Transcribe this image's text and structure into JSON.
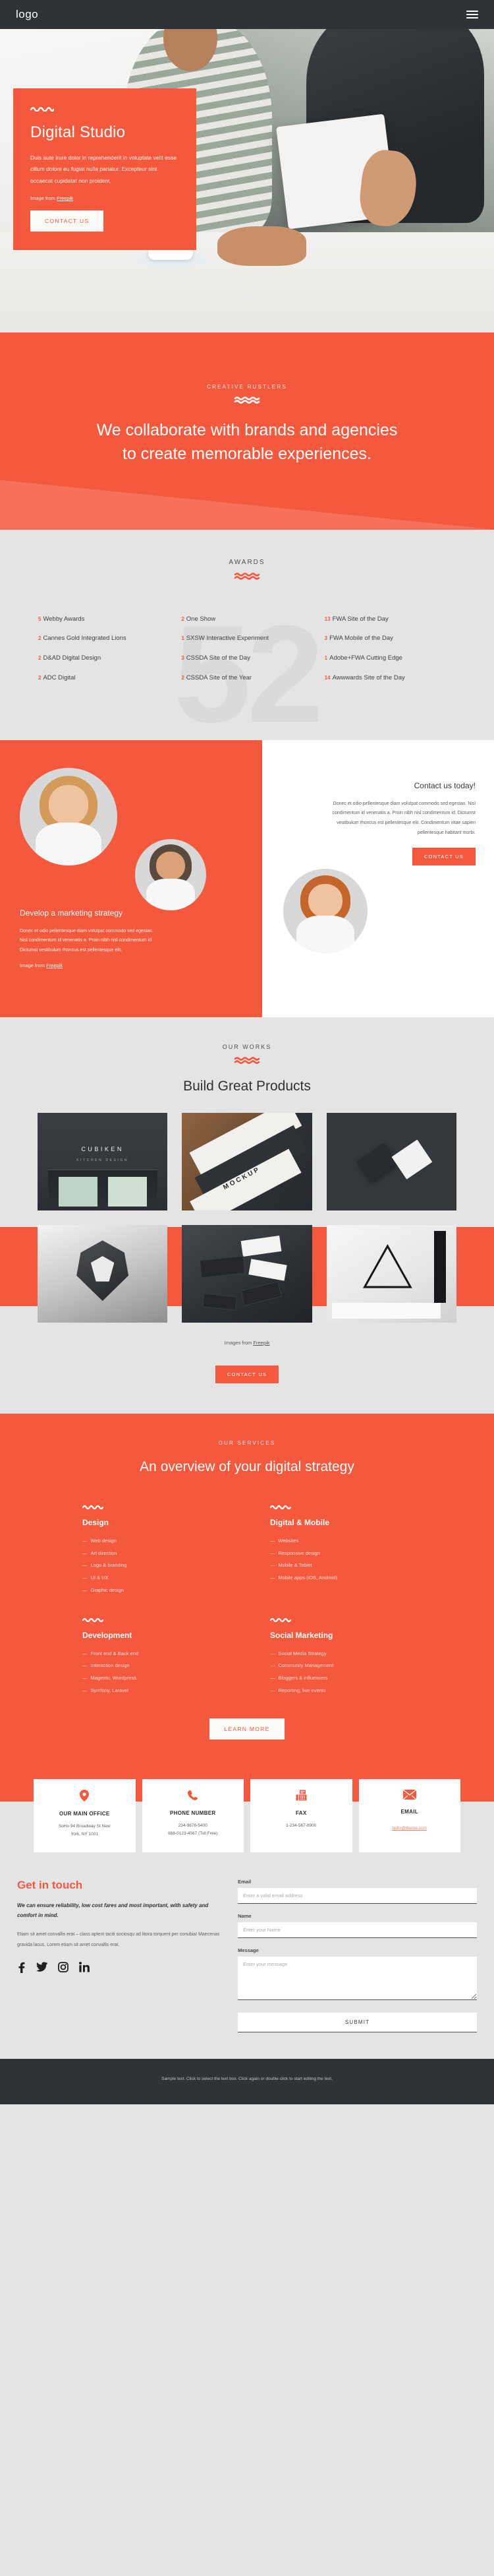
{
  "nav": {
    "logo": "logo",
    "menu_icon": "hamburger-icon"
  },
  "hero": {
    "title": "Digital Studio",
    "paragraph": "Duis aute irure dolor in reprehenderit in voluptate velit esse cillum dolore eu fugiat nulla pariatur. Excepteur sint occaecat cupidatat non proident.",
    "credit_prefix": "Image from ",
    "credit_link": "Freepik",
    "cta": "CONTACT US"
  },
  "collab": {
    "eyebrow": "CREATIVE RUSTLERS",
    "heading": "We collaborate with brands and agencies to create memorable experiences."
  },
  "awards": {
    "eyebrow": "AWARDS",
    "watermark": "52",
    "items": [
      {
        "num": "5",
        "label": "Webby Awards"
      },
      {
        "num": "2",
        "label": "One Show"
      },
      {
        "num": "13",
        "label": "FWA Site of the Day"
      },
      {
        "num": "2",
        "label": "Cannes Gold Integrated Lions"
      },
      {
        "num": "1",
        "label": "SXSW Interactive Experiment"
      },
      {
        "num": "3",
        "label": "FWA Mobile of the Day"
      },
      {
        "num": "2",
        "label": "D&AD Digital Design"
      },
      {
        "num": "3",
        "label": "CSSDA Site of the Day"
      },
      {
        "num": "1",
        "label": "Adobe+FWA Cutting Edge"
      },
      {
        "num": "2",
        "label": "ADC Digital"
      },
      {
        "num": "2",
        "label": "CSSDA Site of the Year"
      },
      {
        "num": "14",
        "label": "Awwwards Site of the Day"
      }
    ]
  },
  "strategy": {
    "title": "Develop a marketing strategy",
    "paragraph": "Donec et odio pellentesque diam volutpat commodo sed egestas. Nisl condimentum id venenatis a. Proin nibh nisl condimentum id. Dictumst vestibulum rhoncus est pellentesque elit.",
    "credit_prefix": "Image from ",
    "credit_link": "Freepik"
  },
  "contact_today": {
    "title": "Contact us today!",
    "paragraph": "Donec et odio pellentesque diam volutpat commodo sed egestas. Nisl condimentum id venenatis a. Proin nibh nisl condimentum id. Dictumst vestibulum rhoncus est pellentesque elit. Condimentum vitae sapien pellentesque habitant morbi.",
    "cta": "CONTACT US"
  },
  "works": {
    "eyebrow": "OUR WORKS",
    "heading": "Build Great Products",
    "credit_prefix": "Images from ",
    "credit_link": "Freepik",
    "cta": "CONTACT US",
    "tiles": [
      {
        "caption": "CUBIKEN",
        "subcaption": "KITCHEN DESIGN"
      },
      {
        "caption": "MOCKUP",
        "subcaption": "MOCKUP"
      },
      {
        "caption": "",
        "subcaption": ""
      },
      {
        "caption": "",
        "subcaption": ""
      },
      {
        "caption": "",
        "subcaption": ""
      },
      {
        "caption": "",
        "subcaption": ""
      }
    ]
  },
  "services": {
    "eyebrow": "OUR SERVICES",
    "heading": "An overview of your digital strategy",
    "learn_more": "LEARN MORE",
    "columns": [
      {
        "title": "Design",
        "items": [
          "Web design",
          "Art direction",
          "Logo & branding",
          "UI & UX",
          "Graphic design"
        ]
      },
      {
        "title": "Digital & Mobile",
        "items": [
          "Websites",
          "Responsive design",
          "Mobile & Tablet",
          "Mobile apps (iOS, Android)"
        ]
      },
      {
        "title": "Development",
        "items": [
          "Front end & Back end",
          "Interaction design",
          "Magento, Wordpress",
          "Symfony, Laravel"
        ]
      },
      {
        "title": "Social Marketing",
        "items": [
          "Social Media Strategy",
          "Community Management",
          "Bloggers & influencers",
          "Reporting, live events"
        ]
      }
    ]
  },
  "contact_cards": [
    {
      "icon": "map-pin-icon",
      "title": "OUR MAIN OFFICE",
      "lines": [
        "SoHo 94 Broadway St New",
        "York, NY 1001"
      ],
      "link": ""
    },
    {
      "icon": "phone-icon",
      "title": "PHONE NUMBER",
      "lines": [
        "234-9876-5400",
        "888-0123-4567 (Toll Free)"
      ],
      "link": ""
    },
    {
      "icon": "fax-icon",
      "title": "FAX",
      "lines": [
        "1-234-567-8900"
      ],
      "link": ""
    },
    {
      "icon": "envelope-icon",
      "title": "EMAIL",
      "lines": [],
      "link": "hello@theme.com"
    }
  ],
  "touch": {
    "heading": "Get in touch",
    "lede": "We can ensure reliability, low cost fares and most important, with safety and comfort in mind.",
    "body": "Etiam sit amet convallis erat – class aptent taciti sociosqu ad litora torquent per conubia! Maecenas gravida lacus. Lorem etiam sit amet convallis erat.",
    "socials": [
      "facebook-icon",
      "twitter-icon",
      "instagram-icon",
      "linkedin-icon"
    ],
    "form": {
      "email_label": "Email",
      "email_placeholder": "Enter a valid email address",
      "email_value": "",
      "name_label": "Name",
      "name_placeholder": "Enter your Name",
      "name_value": "",
      "message_label": "Message",
      "message_placeholder": "Enter your message",
      "message_value": "",
      "submit": "SUBMIT"
    }
  },
  "footer": {
    "text": "Sample text. Click to select the text box. Click again or double click to start editing the text."
  },
  "colors": {
    "accent": "#f4593d",
    "dark": "#2f3237",
    "surface": "#e4e4e4"
  }
}
